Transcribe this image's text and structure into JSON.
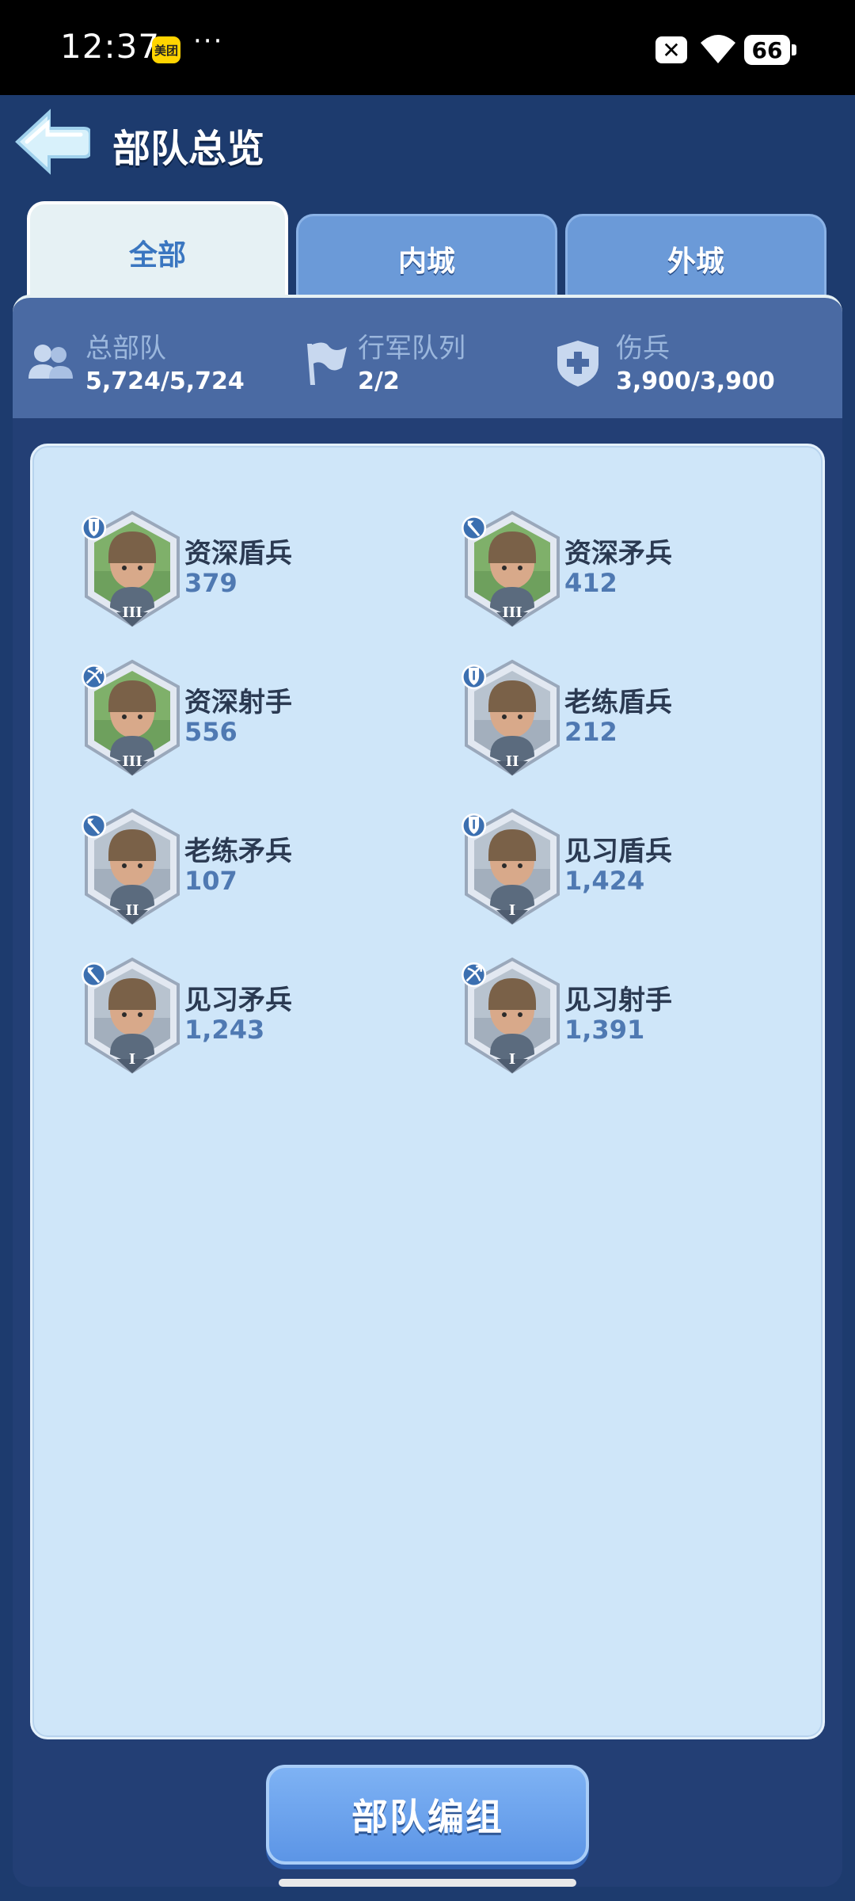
{
  "status_bar": {
    "time": "12:37",
    "app_badge": "美团",
    "dots": "···",
    "close_badge": "✕",
    "battery": "66"
  },
  "header": {
    "title": "部队总览"
  },
  "tabs": [
    {
      "label": "全部",
      "active": true
    },
    {
      "label": "内城",
      "active": false
    },
    {
      "label": "外城",
      "active": false
    }
  ],
  "stats": [
    {
      "label": "总部队",
      "value": "5,724/5,724",
      "icon": "troops-icon"
    },
    {
      "label": "行军队列",
      "value": "2/2",
      "icon": "flag-icon"
    },
    {
      "label": "伤兵",
      "value": "3,900/3,900",
      "icon": "medical-cross-icon"
    }
  ],
  "units": [
    {
      "name": "资深盾兵",
      "count": "379",
      "type": "shield",
      "tier": "III",
      "bg": "green"
    },
    {
      "name": "资深矛兵",
      "count": "412",
      "type": "spear",
      "tier": "III",
      "bg": "green"
    },
    {
      "name": "资深射手",
      "count": "556",
      "type": "bow",
      "tier": "III",
      "bg": "green"
    },
    {
      "name": "老练盾兵",
      "count": "212",
      "type": "shield",
      "tier": "II",
      "bg": "grey"
    },
    {
      "name": "老练矛兵",
      "count": "107",
      "type": "spear",
      "tier": "II",
      "bg": "grey"
    },
    {
      "name": "见习盾兵",
      "count": "1,424",
      "type": "shield",
      "tier": "I",
      "bg": "grey"
    },
    {
      "name": "见习矛兵",
      "count": "1,243",
      "type": "spear",
      "tier": "I",
      "bg": "grey"
    },
    {
      "name": "见习射手",
      "count": "1,391",
      "type": "bow",
      "tier": "I",
      "bg": "grey"
    }
  ],
  "footer": {
    "formation_button": "部队编组"
  },
  "colors": {
    "background": "#1d3b6e",
    "tab_active": "#e6f1f4",
    "tab_inactive": "#6b9ad8",
    "list_bg": "#cfe6f9",
    "button": "#6aa3ee"
  }
}
